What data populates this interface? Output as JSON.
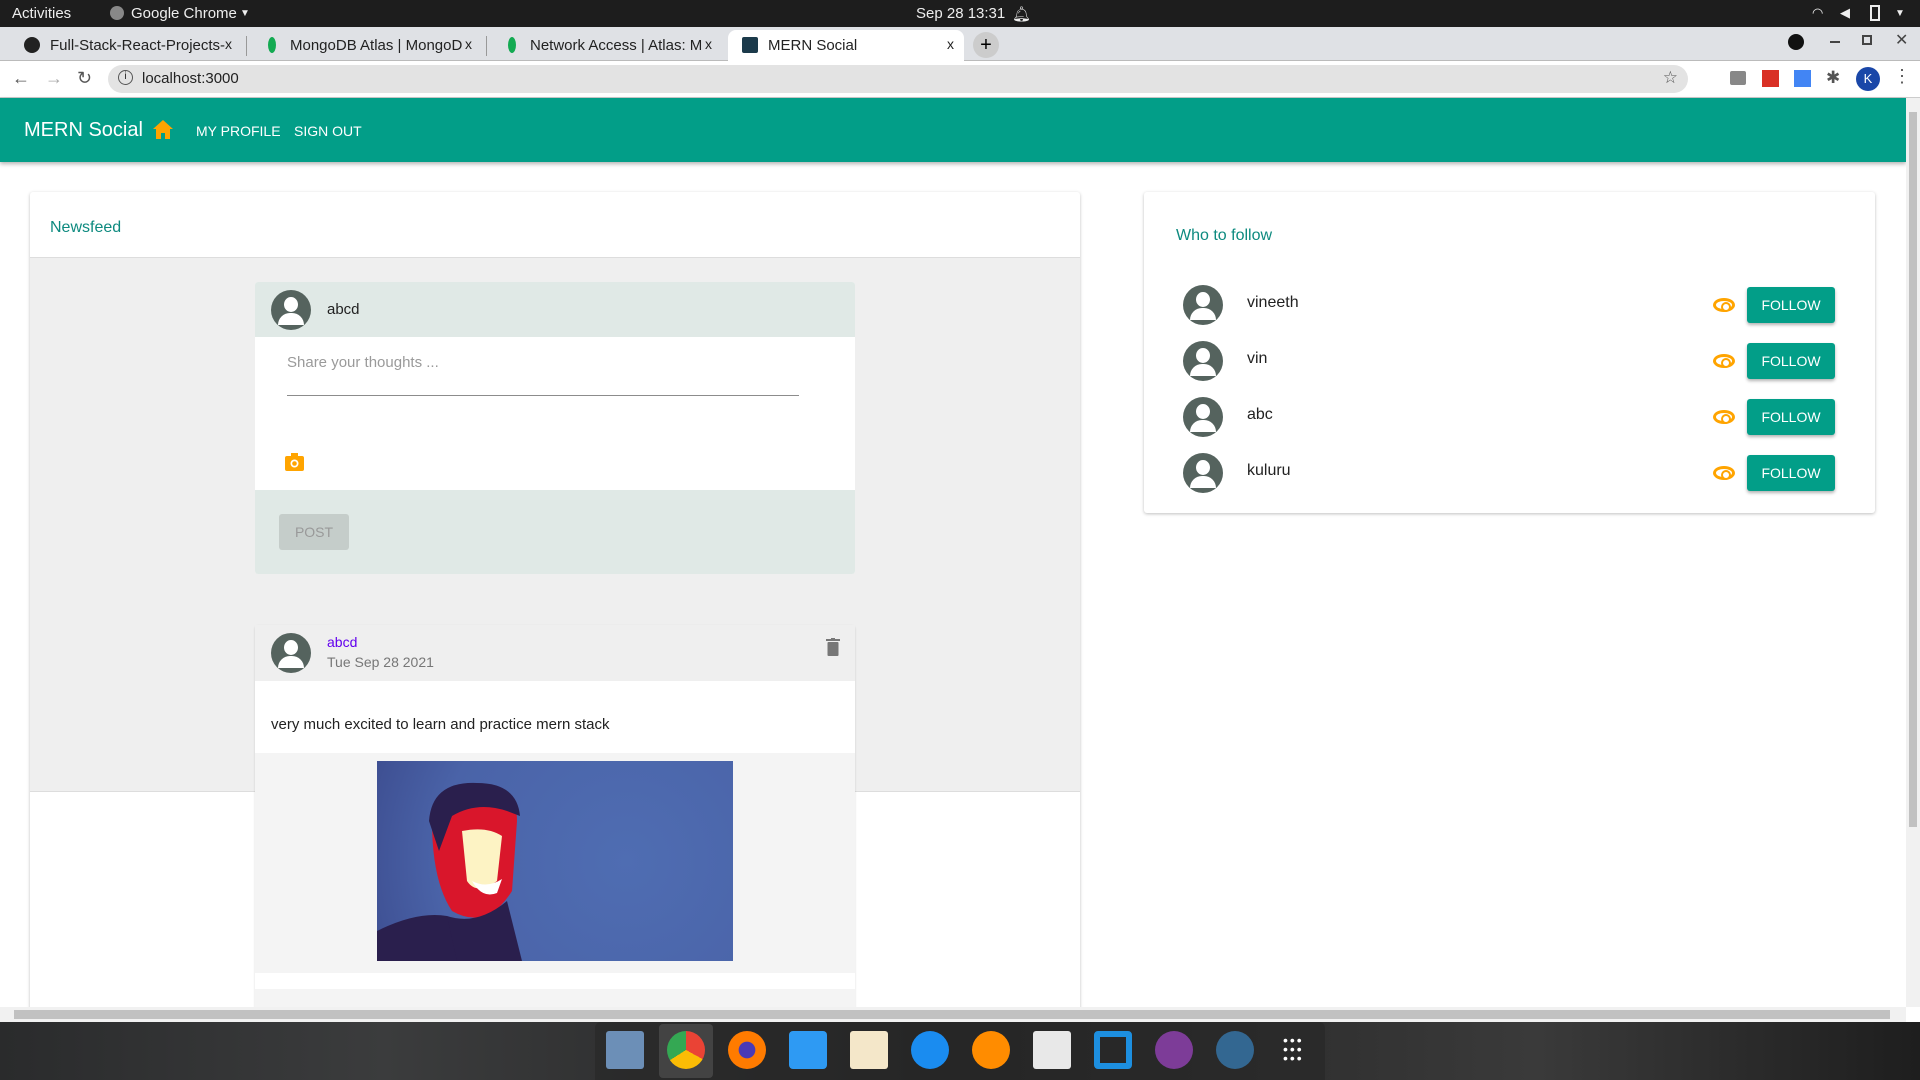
{
  "os": {
    "activities": "Activities",
    "app": "Google Chrome",
    "datetime": "Sep 28  13:31"
  },
  "browser": {
    "tabs": [
      {
        "title": "Full-Stack-React-Projects-"
      },
      {
        "title": "MongoDB Atlas | MongoD"
      },
      {
        "title": "Network Access | Atlas: M"
      },
      {
        "title": "MERN Social"
      }
    ],
    "url": "localhost:3000",
    "profile_initial": "K",
    "close": "x",
    "new_tab": "+"
  },
  "appbar": {
    "brand": "MERN Social",
    "links": [
      "MY PROFILE",
      "SIGN OUT"
    ]
  },
  "newsfeed": {
    "title": "Newsfeed",
    "composer": {
      "user": "abcd",
      "placeholder": "Share your thoughts ...",
      "post_label": "POST"
    },
    "posts": [
      {
        "user": "abcd",
        "date": "Tue Sep 28 2021",
        "text": "very much excited to learn and practice mern stack"
      }
    ]
  },
  "follow": {
    "title": "Who to follow",
    "button_label": "FOLLOW",
    "users": [
      "vineeth",
      "vin",
      "abc",
      "kuluru"
    ]
  },
  "colors": {
    "primary": "#029e88",
    "accent": "#ffa400"
  }
}
